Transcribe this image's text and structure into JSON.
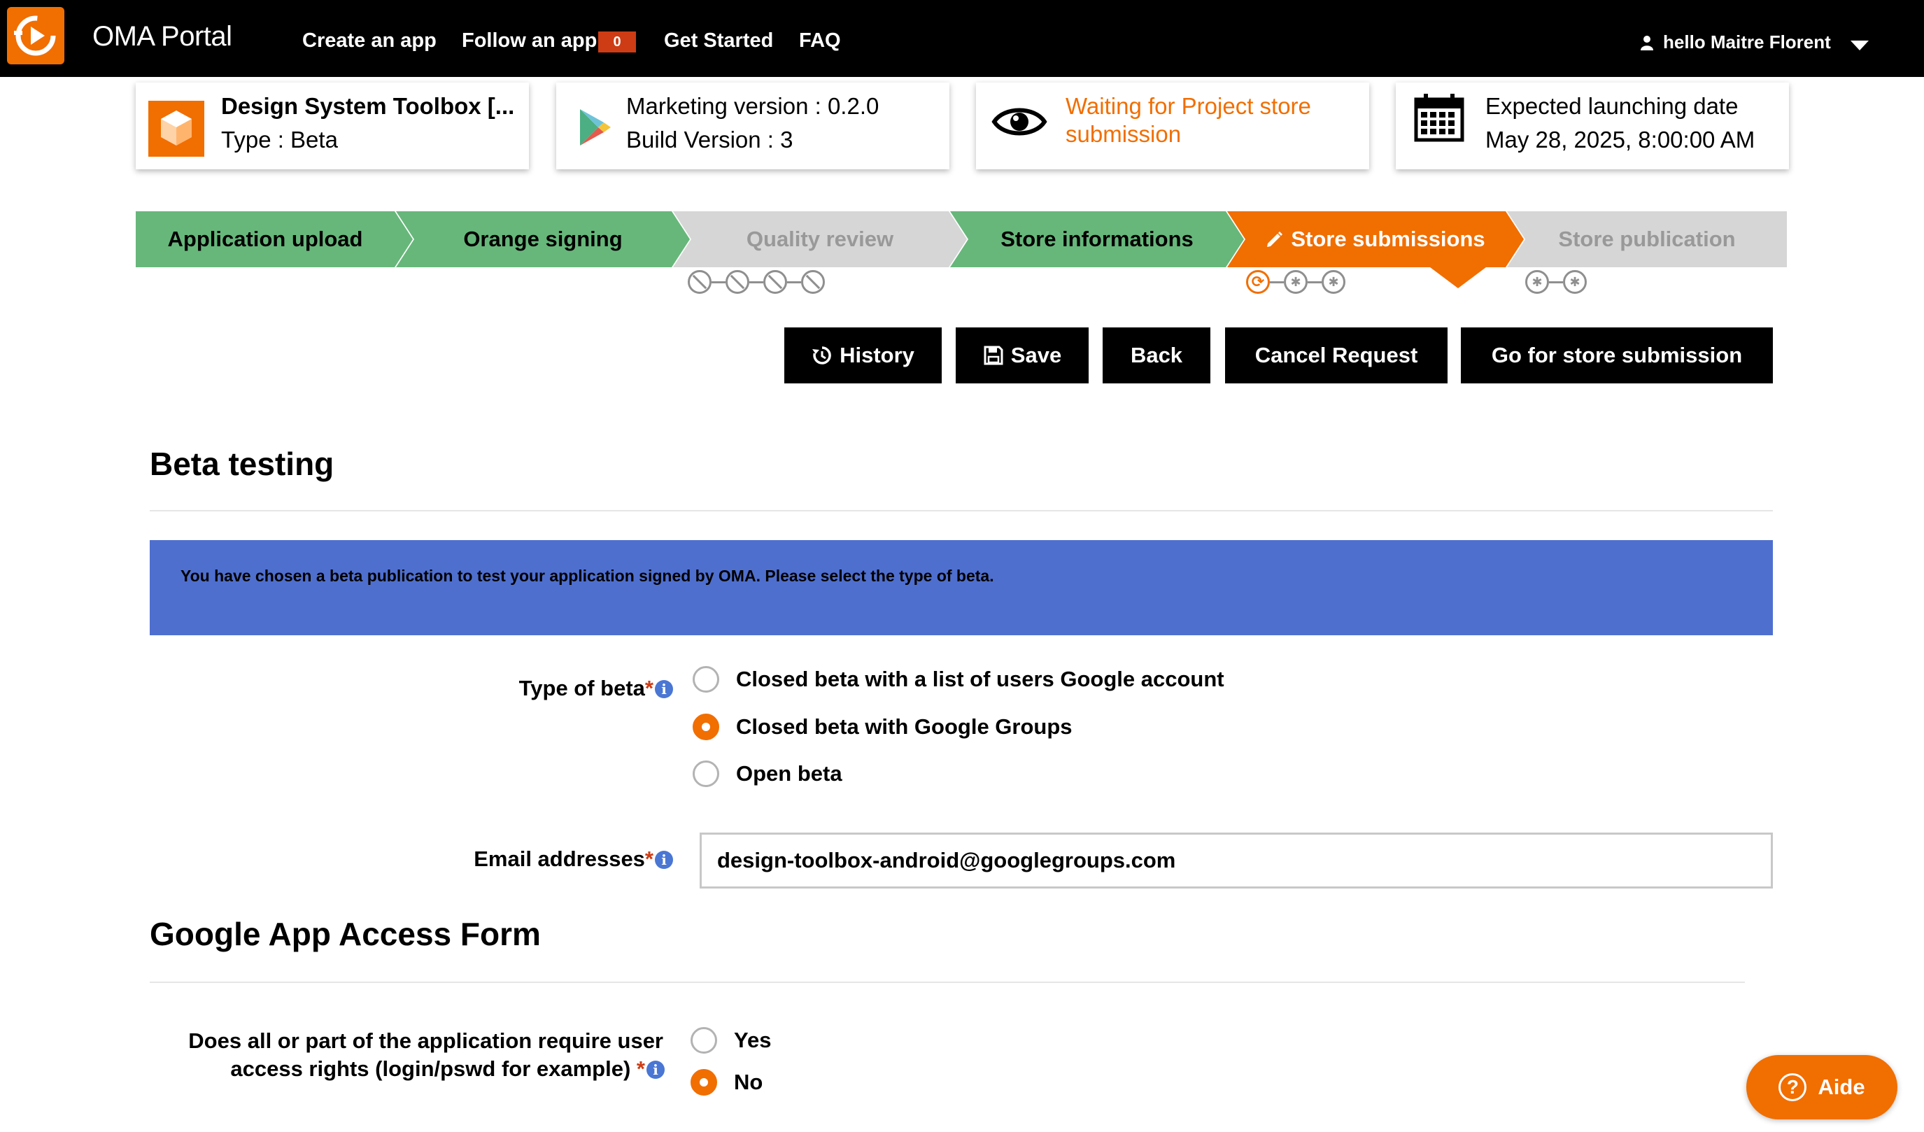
{
  "header": {
    "brand": "OMA Portal",
    "nav": [
      "Create an app",
      "Follow an app",
      "Get Started",
      "FAQ"
    ],
    "follow_badge": "0",
    "user_greeting": "hello Maitre Florent"
  },
  "cards": {
    "app": {
      "name": "Design System Toolbox [...",
      "type": "Type : Beta"
    },
    "version": {
      "marketing": "Marketing version : 0.2.0",
      "build": "Build Version : 3"
    },
    "status": {
      "line1": "Waiting for Project store",
      "line2": "submission"
    },
    "launch": {
      "label": "Expected launching date",
      "date": "May 28, 2025, 8:00:00 AM"
    }
  },
  "steps": [
    {
      "label": "Application upload",
      "state": "done"
    },
    {
      "label": "Orange signing",
      "state": "done"
    },
    {
      "label": "Quality review",
      "state": "disabled"
    },
    {
      "label": "Store informations",
      "state": "done"
    },
    {
      "label": "Store submissions",
      "state": "active"
    },
    {
      "label": "Store publication",
      "state": "disabled"
    }
  ],
  "actions": {
    "history": "History",
    "save": "Save",
    "back": "Back",
    "cancel": "Cancel Request",
    "go": "Go for store submission"
  },
  "beta": {
    "title": "Beta testing",
    "info": "You have chosen a beta publication to test your application signed by OMA. Please select the type of beta.",
    "type_label": "Type of beta",
    "options": [
      "Closed beta with a list of users Google account",
      "Closed beta with Google Groups",
      "Open beta"
    ],
    "selected": 1,
    "email_label": "Email addresses",
    "email_value": "design-toolbox-android@googlegroups.com"
  },
  "access": {
    "title": "Google App Access Form",
    "question_line1": "Does all or part of the application require user",
    "question_line2": "access rights (login/pswd for example)",
    "yes": "Yes",
    "no": "No",
    "selected": "No"
  },
  "help": {
    "label": "Aide"
  },
  "colors": {
    "orange": "#f16e00",
    "green": "#67b77b",
    "grey_step": "#d6d6d6",
    "info_blue": "#4f6fcf",
    "badge_red": "#cd3c14"
  }
}
